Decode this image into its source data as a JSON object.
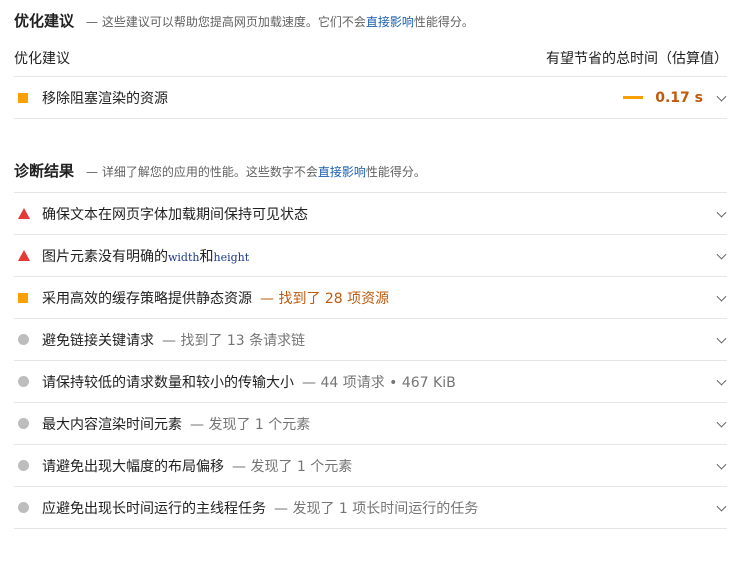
{
  "opportunities": {
    "title": "优化建议",
    "desc_prefix": "— 这些建议可以帮助您提高网页加载速度。它们不会",
    "desc_link": "直接影响",
    "desc_suffix": "性能得分。",
    "col_left": "优化建议",
    "col_right": "有望节省的总时间（估算值）",
    "items": [
      {
        "title": "移除阻塞渲染的资源",
        "savings": "0.17 s",
        "indicator": "orange-square"
      }
    ]
  },
  "diagnostics": {
    "title": "诊断结果",
    "desc_prefix": "— 详细了解您的应用的性能。这些数字不会",
    "desc_link": "直接影响",
    "desc_suffix": "性能得分。",
    "items": [
      {
        "title": "确保文本在网页字体加载期间保持可见状态",
        "sub": "",
        "indicator": "red-triangle"
      },
      {
        "title_pre": "图片元素没有明确的",
        "code1": "width",
        "title_mid": "和",
        "code2": "height",
        "indicator": "red-triangle"
      },
      {
        "title": "采用高效的缓存策略提供静态资源",
        "sub": "— 找到了 28 项资源",
        "indicator": "orange-square"
      },
      {
        "title": "避免链接关键请求",
        "sub": "— 找到了 13 条请求链",
        "indicator": "gray-circle"
      },
      {
        "title": "请保持较低的请求数量和较小的传输大小",
        "sub": "— 44 项请求 • 467 KiB",
        "indicator": "gray-circle"
      },
      {
        "title": "最大内容渲染时间元素",
        "sub": "— 发现了 1 个元素",
        "indicator": "gray-circle"
      },
      {
        "title": "请避免出现大幅度的布局偏移",
        "sub": "— 发现了 1 个元素",
        "indicator": "gray-circle"
      },
      {
        "title": "应避免出现长时间运行的主线程任务",
        "sub": "— 发现了 1 项长时间运行的任务",
        "indicator": "gray-circle"
      }
    ]
  },
  "colors": {
    "fail": "#e53935",
    "average": "#fa9f00",
    "pass_info": "#bdbdbd",
    "warn_text": "#c05a0e",
    "link": "#1a5fb4"
  }
}
